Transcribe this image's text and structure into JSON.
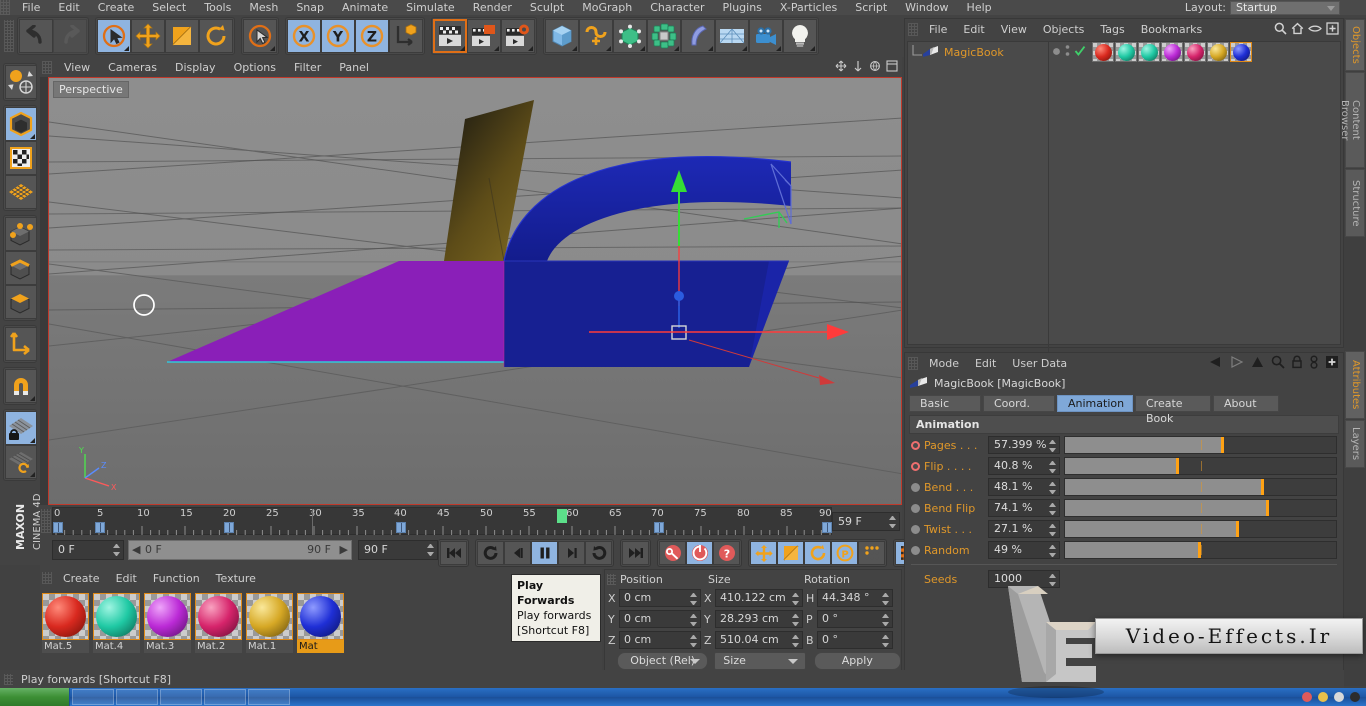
{
  "app": {
    "title": "CINEMA 4D",
    "brand_top": "MAXON",
    "brand_bottom": "CINEMA 4D"
  },
  "menubar": {
    "items": [
      "File",
      "Edit",
      "Create",
      "Select",
      "Tools",
      "Mesh",
      "Snap",
      "Animate",
      "Simulate",
      "Render",
      "Sculpt",
      "MoGraph",
      "Character",
      "Plugins",
      "X-Particles",
      "Script",
      "Window",
      "Help"
    ],
    "layout_label": "Layout:",
    "layout_value": "Startup"
  },
  "toolbar": {
    "groups": [
      {
        "name": "undo-redo",
        "buttons": [
          {
            "name": "undo-icon",
            "label": "Undo",
            "selected": false,
            "dim": false
          },
          {
            "name": "redo-icon",
            "label": "Redo",
            "selected": false,
            "dim": true
          }
        ]
      },
      {
        "name": "transform-tools",
        "buttons": [
          {
            "name": "live-selection-icon",
            "label": "Live Selection",
            "selected": true,
            "dim": false
          },
          {
            "name": "move-icon",
            "label": "Move",
            "selected": false,
            "dim": false
          },
          {
            "name": "scale-icon",
            "label": "Scale",
            "selected": false,
            "dim": false
          },
          {
            "name": "rotate-icon",
            "label": "Rotate",
            "selected": false,
            "dim": false
          }
        ]
      },
      {
        "name": "selection-mode",
        "buttons": [
          {
            "name": "cursor-select-icon",
            "label": "Selection",
            "selected": false,
            "dim": false
          }
        ]
      },
      {
        "name": "axis-locks",
        "buttons": [
          {
            "name": "x-axis-icon",
            "label": "X",
            "selected": true,
            "dim": false
          },
          {
            "name": "y-axis-icon",
            "label": "Y",
            "selected": true,
            "dim": false
          },
          {
            "name": "z-axis-icon",
            "label": "Z",
            "selected": true,
            "dim": false
          },
          {
            "name": "world-coordinates-icon",
            "label": "World/Object",
            "selected": false,
            "dim": false
          }
        ]
      },
      {
        "name": "render-tools",
        "buttons": [
          {
            "name": "render-view-icon",
            "label": "Render View",
            "selected": false,
            "dim": false
          },
          {
            "name": "render-region-icon",
            "label": "Render Region",
            "selected": false,
            "dim": false
          },
          {
            "name": "render-settings-icon",
            "label": "Render Settings",
            "selected": false,
            "dim": false
          }
        ]
      },
      {
        "name": "create-objects",
        "buttons": [
          {
            "name": "cube-primitive-icon",
            "label": "Cube",
            "selected": false,
            "dim": false
          },
          {
            "name": "spline-icon",
            "label": "Spline",
            "selected": false,
            "dim": false
          },
          {
            "name": "nurbs-icon",
            "label": "Generator",
            "selected": false,
            "dim": false
          },
          {
            "name": "array-icon",
            "label": "Array",
            "selected": false,
            "dim": false
          },
          {
            "name": "deformer-icon",
            "label": "Bend Deformer",
            "selected": false,
            "dim": false
          },
          {
            "name": "floor-icon",
            "label": "Floor / Scene",
            "selected": false,
            "dim": false
          },
          {
            "name": "camera-icon",
            "label": "Camera",
            "selected": false,
            "dim": false
          },
          {
            "name": "light-icon",
            "label": "Light",
            "selected": false,
            "dim": false
          }
        ]
      }
    ]
  },
  "left_toolbar": {
    "groups": [
      [
        {
          "name": "render-globe-icon",
          "label": "Interactive Render Region",
          "selected": false
        }
      ],
      [
        {
          "name": "model-mode-icon",
          "label": "Model Mode",
          "selected": true
        },
        {
          "name": "texture-mode-icon",
          "label": "Texture Mode",
          "selected": false
        },
        {
          "name": "polygon-grid-icon",
          "label": "Workplane",
          "selected": false
        }
      ],
      [
        {
          "name": "points-mode-icon",
          "label": "Points",
          "selected": false
        },
        {
          "name": "edges-mode-icon",
          "label": "Edges",
          "selected": false
        },
        {
          "name": "polygons-mode-icon",
          "label": "Polygons",
          "selected": false
        }
      ],
      [
        {
          "name": "axis-mode-icon",
          "label": "Enable Axis",
          "selected": false
        }
      ],
      [
        {
          "name": "magnet-icon",
          "label": "Magnet",
          "selected": false
        }
      ],
      [
        {
          "name": "lock-workplane-icon",
          "label": "Lock Workplane",
          "selected": true
        },
        {
          "name": "planar-workplane-icon",
          "label": "Planar Workplane",
          "selected": false
        }
      ]
    ]
  },
  "viewport": {
    "menu_items": [
      "View",
      "Cameras",
      "Display",
      "Options",
      "Filter",
      "Panel"
    ],
    "label": "Perspective",
    "corner_icons": [
      "pan-viewport-icon",
      "dolly-viewport-icon",
      "rotate-viewport-icon",
      "maximize-viewport-icon"
    ]
  },
  "timeline": {
    "tick_labels": [
      "0",
      "5",
      "10",
      "15",
      "20",
      "25",
      "30",
      "35",
      "40",
      "45",
      "50",
      "55",
      "60",
      "65",
      "70",
      "75",
      "80",
      "85",
      "90"
    ],
    "range_min": 0,
    "range_max": 90,
    "keyframes": [
      0,
      5,
      20,
      40,
      70,
      90
    ],
    "playhead_frame": 59,
    "current_frame_field": "0 F",
    "range_start_label": "0 F",
    "range_end_label": "90 F",
    "end_frame_field": "90 F",
    "frame_indicator": "59 F",
    "transport": [
      {
        "name": "go-to-start-button",
        "label": "Go To Start",
        "selected": false
      },
      {
        "name": "play-backwards-loop-button",
        "label": "Play Backwards",
        "selected": false
      },
      {
        "name": "step-back-button",
        "label": "Previous Frame",
        "selected": false
      },
      {
        "name": "play-forwards-button",
        "label": "Play Forwards",
        "selected": true
      },
      {
        "name": "step-forward-button",
        "label": "Next Frame",
        "selected": false
      },
      {
        "name": "loop-button",
        "label": "Loop",
        "selected": false
      },
      {
        "name": "go-to-end-button",
        "label": "Go To End",
        "selected": false
      },
      {
        "name": "record-key-button",
        "label": "Record Active Objects",
        "selected": false
      },
      {
        "name": "autokey-button",
        "label": "Autokeying",
        "selected": true
      },
      {
        "name": "keyframe-selection-button",
        "label": "Keyframe Selection",
        "selected": false
      },
      {
        "name": "position-key-button",
        "label": "Position",
        "selected": true
      },
      {
        "name": "scale-key-button",
        "label": "Scale",
        "selected": true
      },
      {
        "name": "rotation-key-button",
        "label": "Rotation",
        "selected": true
      },
      {
        "name": "param-key-button",
        "label": "Parameter",
        "selected": true
      },
      {
        "name": "point-level-key-button",
        "label": "PLA",
        "selected": false
      },
      {
        "name": "timeline-button",
        "label": "Timeline",
        "selected": true
      }
    ]
  },
  "materials": {
    "menu_items": [
      "Create",
      "Edit",
      "Function",
      "Texture"
    ],
    "items": [
      {
        "name": "Mat.5",
        "color": "#d9291f",
        "selected": true
      },
      {
        "name": "Mat.4",
        "color": "#1fc9a4",
        "selected": true
      },
      {
        "name": "Mat.3",
        "color": "#bb2ad6",
        "selected": true
      },
      {
        "name": "Mat.2",
        "color": "#d6246b",
        "selected": true
      },
      {
        "name": "Mat.1",
        "color": "#d6a825",
        "selected": true
      },
      {
        "name": "Mat",
        "color": "#1f2fd6",
        "selected": true
      }
    ],
    "active_material": "Mat"
  },
  "coordinates": {
    "headers": [
      "Position",
      "Size",
      "Rotation"
    ],
    "rows": [
      {
        "pos_label": "X",
        "pos_value": "0 cm",
        "size_label": "X",
        "size_value": "410.122 cm",
        "rot_label": "H",
        "rot_value": "44.348 °"
      },
      {
        "pos_label": "Y",
        "pos_value": "0 cm",
        "size_label": "Y",
        "size_value": "28.293 cm",
        "rot_label": "P",
        "rot_value": "0 °"
      },
      {
        "pos_label": "Z",
        "pos_value": "0 cm",
        "size_label": "Z",
        "size_value": "510.04 cm",
        "rot_label": "B",
        "rot_value": "0 °"
      }
    ],
    "mode_dropdown": "Object (Rel)",
    "size_dropdown": "Size",
    "apply_button": "Apply"
  },
  "objects_manager": {
    "menu_items": [
      "File",
      "Edit",
      "View",
      "Objects",
      "Tags",
      "Bookmarks"
    ],
    "header_icons": [
      "search-icon",
      "home-icon",
      "eye-icon",
      "add-panel-icon"
    ],
    "object_name": "MagicBook",
    "object_icon": "magicbook-object-icon",
    "visibility_dot": "visibility-dot-icon",
    "enabled_check": "enabled-check-icon",
    "tags": [
      {
        "name": "material-tag-mat5",
        "color": "#d9291f",
        "selected": false
      },
      {
        "name": "material-tag-mat4a",
        "color": "#1fc9a4",
        "selected": false
      },
      {
        "name": "material-tag-mat4b",
        "color": "#1fc9a4",
        "selected": false
      },
      {
        "name": "material-tag-mat3",
        "color": "#bb2ad6",
        "selected": false
      },
      {
        "name": "material-tag-mat2",
        "color": "#d6246b",
        "selected": false
      },
      {
        "name": "material-tag-mat1",
        "color": "#d6a825",
        "selected": false
      },
      {
        "name": "material-tag-mat",
        "color": "#1f2fd6",
        "selected": true
      }
    ]
  },
  "attributes": {
    "menu_items": [
      "Mode",
      "Edit",
      "User Data"
    ],
    "header_icons": [
      "nav-back-icon",
      "nav-forward-icon",
      "nav-up-icon",
      "search-icon",
      "lock-icon",
      "link-icon",
      "add-panel-icon"
    ],
    "object_title": "MagicBook [MagicBook]",
    "tabs": [
      {
        "label": "Basic",
        "selected": false
      },
      {
        "label": "Coord.",
        "selected": false
      },
      {
        "label": "Animation",
        "selected": true
      },
      {
        "label": "Create Book",
        "selected": false
      },
      {
        "label": "About",
        "selected": false
      }
    ],
    "section_title": "Animation",
    "params": [
      {
        "label": "Pages . . .",
        "value": "57.399 %",
        "percent": 57.399,
        "keyed": true
      },
      {
        "label": "Flip  . . . .",
        "value": "40.8 %",
        "percent": 40.8,
        "keyed": true
      },
      {
        "label": "Bend . . .",
        "value": "48.1 %",
        "percent": 72.5,
        "keyed": false
      },
      {
        "label": "Bend Flip",
        "value": "74.1 %",
        "percent": 74.1,
        "keyed": false
      },
      {
        "label": "Twist . . .",
        "value": "27.1 %",
        "percent": 63.0,
        "keyed": false
      },
      {
        "label": "Random",
        "value": "49 %",
        "percent": 49.0,
        "keyed": false
      }
    ],
    "seeds_label": "Seeds",
    "seeds_value": "1000"
  },
  "side_tabs_top": [
    {
      "label": "Objects",
      "selected": true
    },
    {
      "label": "Content Browser",
      "selected": false
    },
    {
      "label": "Structure",
      "selected": false
    }
  ],
  "side_tabs_bottom": [
    {
      "label": "Attributes",
      "selected": true
    },
    {
      "label": "Layers",
      "selected": false
    }
  ],
  "tooltip": {
    "title": "Play Forwards",
    "description": "Play forwards",
    "shortcut": "[Shortcut F8]"
  },
  "statusbar": {
    "text": "Play forwards [Shortcut F8]"
  },
  "watermark": {
    "text": "Video-Effects.Ir",
    "logo": "VE"
  }
}
